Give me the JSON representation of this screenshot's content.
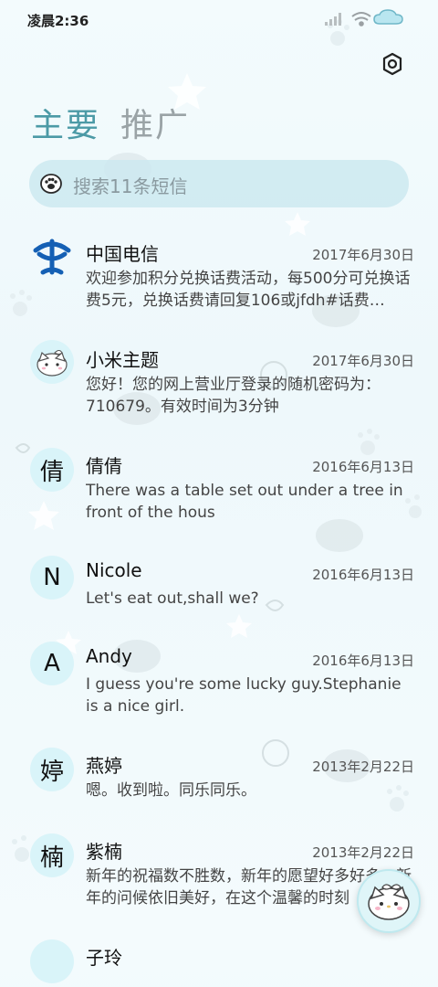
{
  "status_bar": {
    "time": "凌晨2:36",
    "icons": [
      "signal-icon",
      "wifi-icon",
      "battery-icon"
    ]
  },
  "header": {
    "settings_icon": "gear-icon",
    "tabs": [
      {
        "label": "主要",
        "active": true
      },
      {
        "label": "推广",
        "active": false
      }
    ]
  },
  "search": {
    "placeholder": "搜索11条短信",
    "icon": "paw-icon"
  },
  "colors": {
    "accent": "#4c9aa6",
    "search_bg": "#cde9f0",
    "avatar_bg": "#d9f4f9",
    "carrier_blue": "#1560b4"
  },
  "messages": [
    {
      "avatar_type": "logo",
      "avatar_icon": "china-telecom-logo",
      "avatar_text": "",
      "name": "中国电信",
      "date": "2017年6月30日",
      "preview": "欢迎参加积分兑换话费活动，每500分可兑换话费5元，兑换话费请回复106或jfdh#话费…"
    },
    {
      "avatar_type": "image",
      "avatar_icon": "kitty-avatar-icon",
      "avatar_text": "",
      "name": "小米主题",
      "date": "2017年6月30日",
      "preview": "您好！您的网上营业厅登录的随机密码为：710679。有效时间为3分钟"
    },
    {
      "avatar_type": "letter",
      "avatar_icon": "",
      "avatar_text": "倩",
      "name": "倩倩",
      "date": "2016年6月13日",
      "preview": "There was a table set out under a tree in front of the hous"
    },
    {
      "avatar_type": "letter",
      "avatar_icon": "",
      "avatar_text": "N",
      "name": "Nicole",
      "date": "2016年6月13日",
      "preview": "Let's eat out,shall we?"
    },
    {
      "avatar_type": "letter",
      "avatar_icon": "",
      "avatar_text": "A",
      "name": "Andy",
      "date": "2016年6月13日",
      "preview": "I guess you're some lucky guy.Stephanie is a nice girl."
    },
    {
      "avatar_type": "letter",
      "avatar_icon": "",
      "avatar_text": "婷",
      "name": "燕婷",
      "date": "2013年2月22日",
      "preview": "嗯。收到啦。同乐同乐。"
    },
    {
      "avatar_type": "letter",
      "avatar_icon": "",
      "avatar_text": "楠",
      "name": "紫楠",
      "date": "2013年2月22日",
      "preview": "新年的祝福数不胜数，新年的愿望好多好多，新年的问候依旧美好，在这个温馨的时刻"
    },
    {
      "avatar_type": "letter",
      "avatar_icon": "",
      "avatar_text": "",
      "name": "子玲",
      "date": "",
      "preview": ""
    }
  ],
  "fab": {
    "icon": "kitty-compose-icon"
  }
}
